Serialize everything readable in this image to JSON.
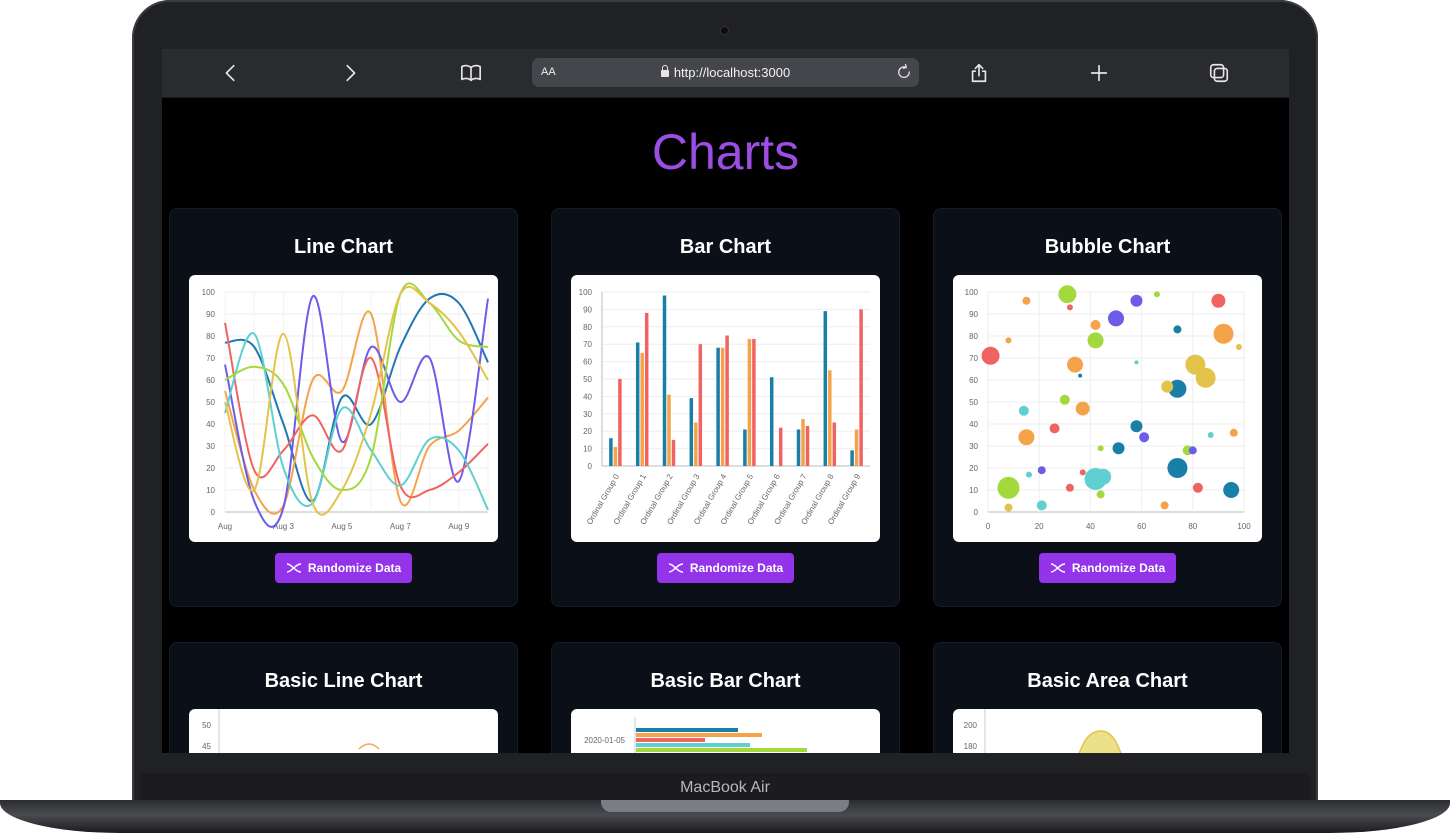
{
  "browser": {
    "font_size_label": "AA",
    "url": "http://localhost:3000"
  },
  "device_label": "MacBook Air",
  "page": {
    "title": "Charts"
  },
  "cards": [
    {
      "title": "Line Chart",
      "button": "Randomize Data"
    },
    {
      "title": "Bar Chart",
      "button": "Randomize Data"
    },
    {
      "title": "Bubble Chart",
      "button": "Randomize Data"
    },
    {
      "title": "Basic Line Chart"
    },
    {
      "title": "Basic Bar Chart"
    },
    {
      "title": "Basic Area Chart"
    }
  ],
  "colors": {
    "accent": "#9333ea",
    "title": "#9b4de4",
    "card_bg": "#0b0f17"
  },
  "chart_data": [
    {
      "type": "line",
      "x_ticks": [
        "Aug",
        "Aug 3",
        "Aug 5",
        "Aug 7",
        "Aug 9"
      ],
      "y_ticks": [
        0,
        10,
        20,
        30,
        40,
        50,
        60,
        70,
        80,
        90,
        100
      ],
      "ylim": [
        0,
        100
      ],
      "series": [
        {
          "color": "#1f77b4",
          "values": [
            77,
            75,
            40,
            5,
            52,
            40,
            75,
            97,
            95,
            68
          ]
        },
        {
          "color": "#f5a34a",
          "values": [
            55,
            10,
            3,
            60,
            55,
            90,
            5,
            30,
            37,
            52
          ]
        },
        {
          "color": "#6c5ce7",
          "values": [
            67,
            5,
            2,
            98,
            32,
            75,
            50,
            70,
            14,
            97
          ]
        },
        {
          "color": "#ef6461",
          "values": [
            86,
            19,
            28,
            44,
            28,
            70,
            12,
            10,
            18,
            31
          ]
        },
        {
          "color": "#5fcfd0",
          "values": [
            45,
            81,
            20,
            4,
            47,
            28,
            12,
            33,
            28,
            1
          ]
        },
        {
          "color": "#a3d93c",
          "values": [
            60,
            66,
            58,
            25,
            10,
            25,
            99,
            95,
            78,
            75
          ]
        },
        {
          "color": "#e2c44a",
          "values": [
            50,
            10,
            81,
            4,
            10,
            45,
            99,
            95,
            82,
            60
          ]
        }
      ]
    },
    {
      "type": "bar",
      "categories": [
        "Ordinal Group 0",
        "Ordinal Group 1",
        "Ordinal Group 2",
        "Ordinal Group 3",
        "Ordinal Group 4",
        "Ordinal Group 5",
        "Ordinal Group 6",
        "Ordinal Group 7",
        "Ordinal Group 8",
        "Ordinal Group 9"
      ],
      "y_ticks": [
        0,
        10,
        20,
        30,
        40,
        50,
        60,
        70,
        80,
        90,
        100
      ],
      "ylim": [
        0,
        100
      ],
      "series": [
        {
          "color": "#1a7fa6",
          "values": [
            16,
            71,
            98,
            39,
            68,
            21,
            51,
            21,
            89,
            9
          ]
        },
        {
          "color": "#f5a34a",
          "values": [
            11,
            65,
            41,
            25,
            68,
            73,
            0,
            27,
            55,
            21
          ]
        },
        {
          "color": "#ef6461",
          "values": [
            50,
            88,
            15,
            70,
            75,
            73,
            22,
            23,
            25,
            90
          ]
        }
      ]
    },
    {
      "type": "scatter",
      "x_ticks": [
        0,
        20,
        40,
        60,
        80,
        100
      ],
      "y_ticks": [
        0,
        10,
        20,
        30,
        40,
        50,
        60,
        70,
        80,
        90,
        100
      ],
      "xlim": [
        0,
        100
      ],
      "ylim": [
        0,
        100
      ],
      "points": [
        {
          "x": 1,
          "y": 71,
          "r": 9,
          "color": "#ef6461"
        },
        {
          "x": 15,
          "y": 96,
          "r": 4,
          "color": "#f5a34a"
        },
        {
          "x": 31,
          "y": 99,
          "r": 9,
          "color": "#a3d93c"
        },
        {
          "x": 32,
          "y": 93,
          "r": 3,
          "color": "#ef6461"
        },
        {
          "x": 42,
          "y": 85,
          "r": 5,
          "color": "#f5a34a"
        },
        {
          "x": 50,
          "y": 88,
          "r": 8,
          "color": "#6c5ce7"
        },
        {
          "x": 58,
          "y": 96,
          "r": 6,
          "color": "#6c5ce7"
        },
        {
          "x": 66,
          "y": 99,
          "r": 3,
          "color": "#a3d93c"
        },
        {
          "x": 90,
          "y": 96,
          "r": 7,
          "color": "#ef6461"
        },
        {
          "x": 42,
          "y": 78,
          "r": 8,
          "color": "#a3d93c"
        },
        {
          "x": 8,
          "y": 78,
          "r": 3,
          "color": "#f5a34a"
        },
        {
          "x": 34,
          "y": 67,
          "r": 8,
          "color": "#f5a34a"
        },
        {
          "x": 36,
          "y": 62,
          "r": 2,
          "color": "#1a7fa6"
        },
        {
          "x": 58,
          "y": 68,
          "r": 2,
          "color": "#5fcfd0"
        },
        {
          "x": 74,
          "y": 83,
          "r": 4,
          "color": "#1a7fa6"
        },
        {
          "x": 92,
          "y": 81,
          "r": 10,
          "color": "#f5a34a"
        },
        {
          "x": 81,
          "y": 67,
          "r": 10,
          "color": "#e2c44a"
        },
        {
          "x": 85,
          "y": 61,
          "r": 10,
          "color": "#e2c44a"
        },
        {
          "x": 98,
          "y": 75,
          "r": 3,
          "color": "#e2c44a"
        },
        {
          "x": 74,
          "y": 56,
          "r": 9,
          "color": "#1a7fa6"
        },
        {
          "x": 70,
          "y": 57,
          "r": 6,
          "color": "#e2c44a"
        },
        {
          "x": 30,
          "y": 51,
          "r": 5,
          "color": "#a3d93c"
        },
        {
          "x": 37,
          "y": 47,
          "r": 7,
          "color": "#f5a34a"
        },
        {
          "x": 14,
          "y": 46,
          "r": 5,
          "color": "#5fcfd0"
        },
        {
          "x": 26,
          "y": 38,
          "r": 5,
          "color": "#ef6461"
        },
        {
          "x": 15,
          "y": 34,
          "r": 8,
          "color": "#f5a34a"
        },
        {
          "x": 58,
          "y": 39,
          "r": 6,
          "color": "#1a7fa6"
        },
        {
          "x": 61,
          "y": 34,
          "r": 5,
          "color": "#6c5ce7"
        },
        {
          "x": 51,
          "y": 29,
          "r": 6,
          "color": "#1a7fa6"
        },
        {
          "x": 44,
          "y": 29,
          "r": 3,
          "color": "#a3d93c"
        },
        {
          "x": 21,
          "y": 19,
          "r": 4,
          "color": "#6c5ce7"
        },
        {
          "x": 16,
          "y": 17,
          "r": 3,
          "color": "#5fcfd0"
        },
        {
          "x": 37,
          "y": 18,
          "r": 3,
          "color": "#ef6461"
        },
        {
          "x": 42,
          "y": 15,
          "r": 11,
          "color": "#5fcfd0"
        },
        {
          "x": 45,
          "y": 16,
          "r": 8,
          "color": "#5fcfd0"
        },
        {
          "x": 74,
          "y": 20,
          "r": 10,
          "color": "#1a7fa6"
        },
        {
          "x": 78,
          "y": 28,
          "r": 5,
          "color": "#a3d93c"
        },
        {
          "x": 80,
          "y": 28,
          "r": 4,
          "color": "#6c5ce7"
        },
        {
          "x": 8,
          "y": 11,
          "r": 11,
          "color": "#a3d93c"
        },
        {
          "x": 21,
          "y": 3,
          "r": 5,
          "color": "#5fcfd0"
        },
        {
          "x": 8,
          "y": 2,
          "r": 4,
          "color": "#e2c44a"
        },
        {
          "x": 32,
          "y": 11,
          "r": 4,
          "color": "#ef6461"
        },
        {
          "x": 44,
          "y": 8,
          "r": 4,
          "color": "#a3d93c"
        },
        {
          "x": 69,
          "y": 3,
          "r": 4,
          "color": "#f5a34a"
        },
        {
          "x": 82,
          "y": 11,
          "r": 5,
          "color": "#ef6461"
        },
        {
          "x": 95,
          "y": 10,
          "r": 8,
          "color": "#1a7fa6"
        },
        {
          "x": 96,
          "y": 36,
          "r": 4,
          "color": "#f5a34a"
        },
        {
          "x": 87,
          "y": 35,
          "r": 3,
          "color": "#5fcfd0"
        }
      ]
    }
  ]
}
